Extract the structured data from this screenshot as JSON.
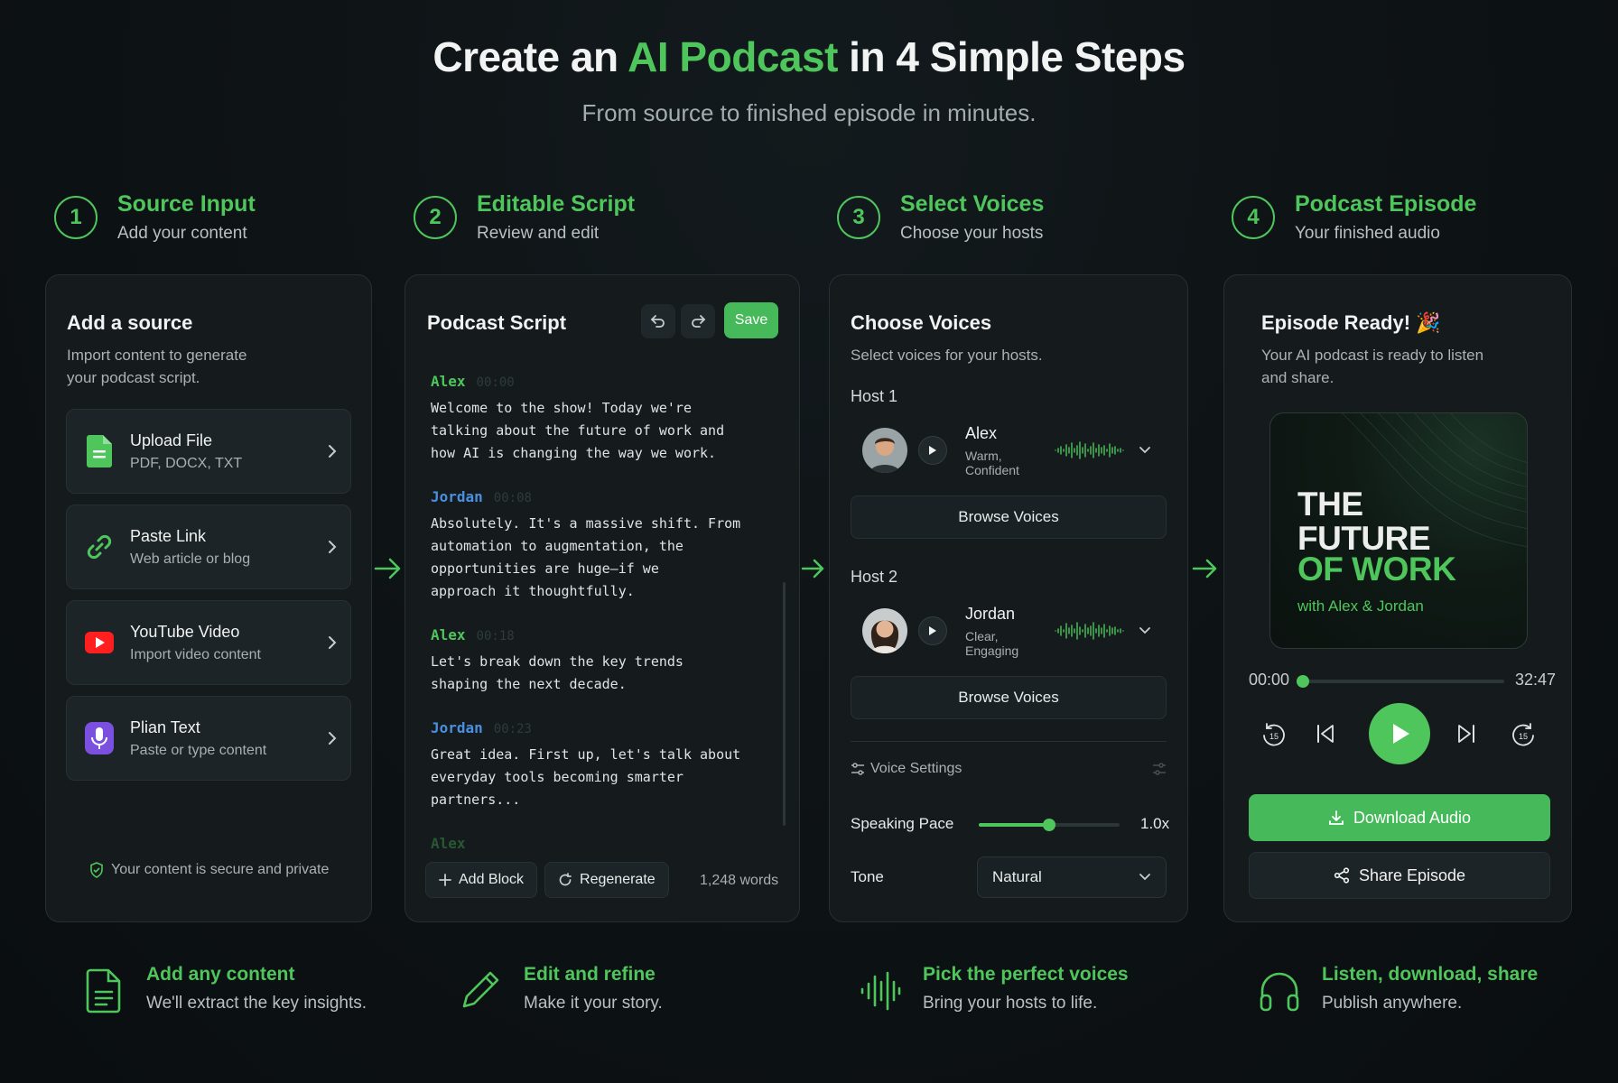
{
  "hero": {
    "title_pre": "Create an ",
    "title_accent": "AI Podcast",
    "title_post": " in 4 Simple Steps",
    "subtitle": "From source to finished episode in minutes."
  },
  "steps": [
    {
      "num": "1",
      "title": "Source Input",
      "sub": "Add your content"
    },
    {
      "num": "2",
      "title": "Editable Script",
      "sub": "Review and edit"
    },
    {
      "num": "3",
      "title": "Select Voices",
      "sub": "Choose your hosts"
    },
    {
      "num": "4",
      "title": "Podcast Episode",
      "sub": "Your finished audio"
    }
  ],
  "source_panel": {
    "title": "Add a source",
    "desc1": "Import content to generate",
    "desc2": "your podcast script.",
    "items": [
      {
        "title": "Upload File",
        "sub": "PDF, DOCX, TXT",
        "icon": "file-icon"
      },
      {
        "title": "Paste Link",
        "sub": "Web article or blog",
        "icon": "link-icon"
      },
      {
        "title": "YouTube Video",
        "sub": "Import video content",
        "icon": "youtube-icon"
      },
      {
        "title": "Plian Text",
        "sub": "Paste or type content",
        "icon": "microphone-icon"
      }
    ],
    "secure_note": "Your content is secure and private"
  },
  "script_panel": {
    "title": "Podcast Script",
    "save_label": "Save",
    "blocks": [
      {
        "speaker": "Alex",
        "time": "00:00",
        "text": "Welcome to the show! Today we're\ntalking about the future of work and\nhow AI is changing the way we work."
      },
      {
        "speaker": "Jordan",
        "time": "00:08",
        "text": "Absolutely. It's a massive shift. From\nautomation to augmentation, the\nopportunities are huge—if we\napproach it thoughtfully."
      },
      {
        "speaker": "Alex",
        "time": "00:18",
        "text": "Let's break down the key trends\nshaping the next decade."
      },
      {
        "speaker": "Jordan",
        "time": "00:23",
        "text": "Great idea. First up, let's talk about\neveryday tools becoming smarter\npartners..."
      },
      {
        "speaker": "Alex",
        "time": "",
        "text": ""
      }
    ],
    "add_block_label": "Add Block",
    "regenerate_label": "Regenerate",
    "word_count": "1,248 words"
  },
  "voices_panel": {
    "title": "Choose Voices",
    "desc": "Select voices for your hosts.",
    "host1_label": "Host 1",
    "host1": {
      "name": "Alex",
      "desc": "Warm, Confident"
    },
    "host2_label": "Host 2",
    "host2": {
      "name": "Jordan",
      "desc": "Clear, Engaging"
    },
    "browse_label": "Browse Voices",
    "voice_settings_label": "Voice Settings",
    "pace_label": "Speaking Pace",
    "pace_value": "1.0x",
    "pace_level": 0.5,
    "tone_label": "Tone",
    "tone_value": "Natural"
  },
  "episode_panel": {
    "title": "Episode Ready! 🎉",
    "desc1": "Your AI podcast is ready to listen",
    "desc2": "and share.",
    "cover_line1": "THE",
    "cover_line2": "FUTURE",
    "cover_line3": "OF WORK",
    "cover_sub": "with Alex & Jordan",
    "time_current": "00:00",
    "time_total": "32:47",
    "progress": 0.0,
    "download_label": "Download Audio",
    "share_label": "Share Episode"
  },
  "features": [
    {
      "title": "Add any content",
      "sub": "We'll extract the key insights.",
      "icon": "document-icon"
    },
    {
      "title": "Edit and refine",
      "sub": "Make it your story.",
      "icon": "pencil-icon"
    },
    {
      "title": "Pick the perfect voices",
      "sub": "Bring your hosts to life.",
      "icon": "waveform-icon"
    },
    {
      "title": "Listen, download, share",
      "sub": "Publish anywhere.",
      "icon": "headphones-icon"
    }
  ],
  "colors": {
    "accent": "#4fc65c",
    "jordan": "#4a8fe0",
    "background": "#0d1214",
    "panel": "#151b1d"
  }
}
